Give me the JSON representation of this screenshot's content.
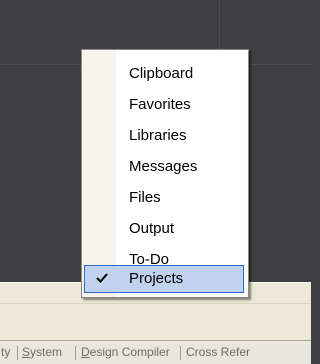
{
  "menu": {
    "items": [
      {
        "label": "Clipboard",
        "checked": false
      },
      {
        "label": "Favorites",
        "checked": false
      },
      {
        "label": "Libraries",
        "checked": false
      },
      {
        "label": "Messages",
        "checked": false
      },
      {
        "label": "Files",
        "checked": false
      },
      {
        "label": "Output",
        "checked": false
      },
      {
        "label": "To-Do",
        "checked": false
      },
      {
        "label": "Projects",
        "checked": true
      }
    ]
  },
  "tabs": {
    "partial_left": "ty",
    "system": {
      "hotkey": "S",
      "rest": "ystem"
    },
    "design_compiler": {
      "hotkey": "D",
      "rest": "esign Compiler"
    },
    "cross_ref": "Cross Refer"
  },
  "colors": {
    "workspace": "#3f3f41",
    "menu_bg": "#ffffff",
    "menu_gutter": "#f5f3ea",
    "selection_fill": "#c1d2ee",
    "selection_border": "#316ac5",
    "panel": "#ece9d8"
  },
  "icons": {
    "checked": "checkmark-icon"
  }
}
